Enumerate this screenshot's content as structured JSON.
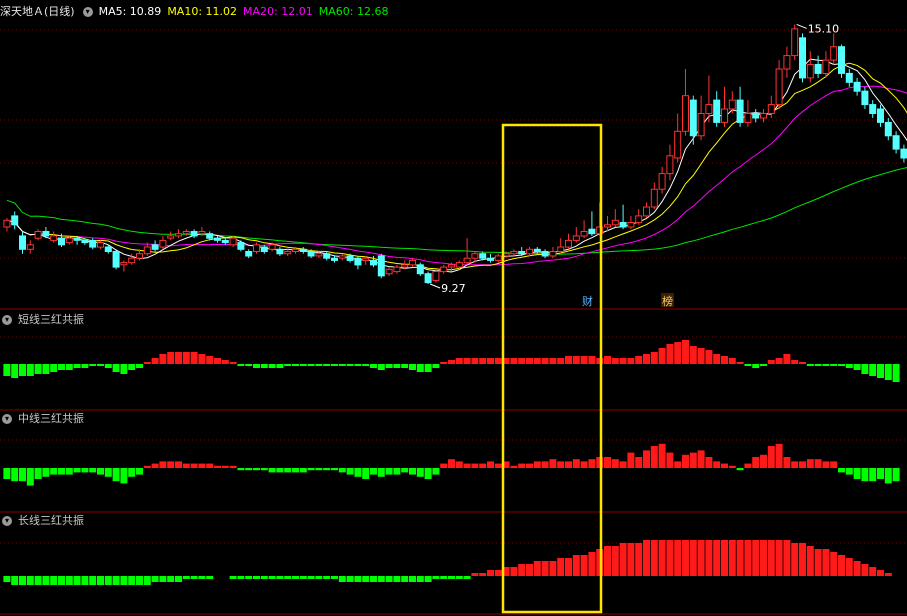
{
  "header": {
    "stock_name": "深天地Ａ",
    "period": "(日线)",
    "ma5": "MA5: 10.89",
    "ma10": "MA10: 11.02",
    "ma20": "MA20: 12.01",
    "ma60": "MA60: 12.68"
  },
  "colors": {
    "up": "#ff3232",
    "down": "#54ffff",
    "ma5": "#ffffff",
    "ma10": "#ffff00",
    "ma20": "#ff00ff",
    "ma60": "#00e600",
    "grid": "#7a0000",
    "highlight": "#ffe400",
    "hist_pos": "#ff1a1a",
    "hist_neg": "#00ff00"
  },
  "price_panel": {
    "high_label": "15.10",
    "low_label": "9.27",
    "marker_cai": "财",
    "marker_bang": "榜"
  },
  "indicators": [
    {
      "title": "短线三红共振"
    },
    {
      "title": "中线三红共振"
    },
    {
      "title": "长线三红共振"
    }
  ],
  "chart_data": {
    "type": "candlestick",
    "price_range": [
      9.0,
      15.2
    ],
    "candles": [
      {
        "o": 10.55,
        "c": 10.7,
        "h": 10.75,
        "l": 10.45
      },
      {
        "o": 10.8,
        "c": 10.6,
        "h": 10.9,
        "l": 10.5
      },
      {
        "o": 10.35,
        "c": 10.05,
        "h": 10.45,
        "l": 9.95
      },
      {
        "o": 10.05,
        "c": 10.15,
        "h": 10.25,
        "l": 9.95
      },
      {
        "o": 10.3,
        "c": 10.45,
        "h": 10.5,
        "l": 10.25
      },
      {
        "o": 10.45,
        "c": 10.35,
        "h": 10.55,
        "l": 10.3
      },
      {
        "o": 10.25,
        "c": 10.35,
        "h": 10.45,
        "l": 10.2
      },
      {
        "o": 10.3,
        "c": 10.15,
        "h": 10.4,
        "l": 10.1
      },
      {
        "o": 10.2,
        "c": 10.3,
        "h": 10.35,
        "l": 10.15
      },
      {
        "o": 10.3,
        "c": 10.25,
        "h": 10.35,
        "l": 10.15
      },
      {
        "o": 10.25,
        "c": 10.2,
        "h": 10.3,
        "l": 10.15
      },
      {
        "o": 10.25,
        "c": 10.1,
        "h": 10.3,
        "l": 10.05
      },
      {
        "o": 10.1,
        "c": 10.2,
        "h": 10.25,
        "l": 10.05
      },
      {
        "o": 10.1,
        "c": 10.0,
        "h": 10.15,
        "l": 9.95
      },
      {
        "o": 10.0,
        "c": 9.65,
        "h": 10.05,
        "l": 9.6
      },
      {
        "o": 9.7,
        "c": 9.75,
        "h": 9.8,
        "l": 9.55
      },
      {
        "o": 9.75,
        "c": 9.85,
        "h": 9.95,
        "l": 9.7
      },
      {
        "o": 9.85,
        "c": 9.95,
        "h": 10.05,
        "l": 9.8
      },
      {
        "o": 9.95,
        "c": 10.1,
        "h": 10.2,
        "l": 9.9
      },
      {
        "o": 10.15,
        "c": 10.05,
        "h": 10.25,
        "l": 10.0
      },
      {
        "o": 10.1,
        "c": 10.25,
        "h": 10.35,
        "l": 10.05
      },
      {
        "o": 10.3,
        "c": 10.35,
        "h": 10.45,
        "l": 10.25
      },
      {
        "o": 10.35,
        "c": 10.4,
        "h": 10.5,
        "l": 10.3
      },
      {
        "o": 10.4,
        "c": 10.45,
        "h": 10.5,
        "l": 10.35
      },
      {
        "o": 10.45,
        "c": 10.35,
        "h": 10.5,
        "l": 10.3
      },
      {
        "o": 10.4,
        "c": 10.45,
        "h": 10.55,
        "l": 10.35
      },
      {
        "o": 10.4,
        "c": 10.3,
        "h": 10.45,
        "l": 10.25
      },
      {
        "o": 10.3,
        "c": 10.25,
        "h": 10.35,
        "l": 10.2
      },
      {
        "o": 10.25,
        "c": 10.2,
        "h": 10.3,
        "l": 10.15
      },
      {
        "o": 10.15,
        "c": 10.3,
        "h": 10.35,
        "l": 10.1
      },
      {
        "o": 10.2,
        "c": 10.05,
        "h": 10.25,
        "l": 10.0
      },
      {
        "o": 10.0,
        "c": 9.9,
        "h": 10.05,
        "l": 9.85
      },
      {
        "o": 10.0,
        "c": 10.15,
        "h": 10.2,
        "l": 9.95
      },
      {
        "o": 10.1,
        "c": 10.0,
        "h": 10.15,
        "l": 9.95
      },
      {
        "o": 10.05,
        "c": 10.15,
        "h": 10.2,
        "l": 10.0
      },
      {
        "o": 10.05,
        "c": 9.95,
        "h": 10.1,
        "l": 9.9
      },
      {
        "o": 9.95,
        "c": 10.0,
        "h": 10.05,
        "l": 9.9
      },
      {
        "o": 10.0,
        "c": 10.05,
        "h": 10.1,
        "l": 9.95
      },
      {
        "o": 10.05,
        "c": 10.0,
        "h": 10.1,
        "l": 9.95
      },
      {
        "o": 10.0,
        "c": 9.9,
        "h": 10.05,
        "l": 9.85
      },
      {
        "o": 9.9,
        "c": 9.95,
        "h": 10.0,
        "l": 9.85
      },
      {
        "o": 9.95,
        "c": 9.85,
        "h": 10.0,
        "l": 9.8
      },
      {
        "o": 9.85,
        "c": 9.8,
        "h": 9.9,
        "l": 9.75
      },
      {
        "o": 9.85,
        "c": 9.9,
        "h": 9.95,
        "l": 9.8
      },
      {
        "o": 9.9,
        "c": 9.8,
        "h": 9.95,
        "l": 9.75
      },
      {
        "o": 9.85,
        "c": 9.7,
        "h": 9.9,
        "l": 9.6
      },
      {
        "o": 9.8,
        "c": 9.85,
        "h": 9.9,
        "l": 9.7
      },
      {
        "o": 9.8,
        "c": 9.7,
        "h": 9.9,
        "l": 9.65
      },
      {
        "o": 9.9,
        "c": 9.45,
        "h": 9.95,
        "l": 9.4
      },
      {
        "o": 9.5,
        "c": 9.6,
        "h": 9.65,
        "l": 9.45
      },
      {
        "o": 9.55,
        "c": 9.65,
        "h": 9.7,
        "l": 9.5
      },
      {
        "o": 9.65,
        "c": 9.7,
        "h": 9.8,
        "l": 9.6
      },
      {
        "o": 9.7,
        "c": 9.8,
        "h": 9.85,
        "l": 9.65
      },
      {
        "o": 9.7,
        "c": 9.5,
        "h": 9.75,
        "l": 9.45
      },
      {
        "o": 9.5,
        "c": 9.3,
        "h": 9.55,
        "l": 9.27
      },
      {
        "o": 9.35,
        "c": 9.55,
        "h": 9.6,
        "l": 9.3
      },
      {
        "o": 9.55,
        "c": 9.65,
        "h": 9.7,
        "l": 9.5
      },
      {
        "o": 9.65,
        "c": 9.7,
        "h": 9.75,
        "l": 9.55
      },
      {
        "o": 9.65,
        "c": 9.75,
        "h": 9.8,
        "l": 9.6
      },
      {
        "o": 9.75,
        "c": 9.85,
        "h": 10.3,
        "l": 9.7
      },
      {
        "o": 9.85,
        "c": 9.95,
        "h": 10.0,
        "l": 9.75
      },
      {
        "o": 9.95,
        "c": 9.85,
        "h": 10.0,
        "l": 9.8
      },
      {
        "o": 9.85,
        "c": 9.8,
        "h": 9.95,
        "l": 9.75
      },
      {
        "o": 9.8,
        "c": 9.9,
        "h": 9.95,
        "l": 9.75
      },
      {
        "o": 9.9,
        "c": 9.95,
        "h": 10.0,
        "l": 9.85
      },
      {
        "o": 9.95,
        "c": 10.0,
        "h": 10.05,
        "l": 9.9
      },
      {
        "o": 10.0,
        "c": 9.95,
        "h": 10.1,
        "l": 9.9
      },
      {
        "o": 9.95,
        "c": 10.05,
        "h": 10.1,
        "l": 9.9
      },
      {
        "o": 10.05,
        "c": 10.0,
        "h": 10.1,
        "l": 9.95
      },
      {
        "o": 10.0,
        "c": 9.9,
        "h": 10.05,
        "l": 9.85
      },
      {
        "o": 9.9,
        "c": 10.0,
        "h": 10.1,
        "l": 9.85
      },
      {
        "o": 10.0,
        "c": 10.1,
        "h": 10.3,
        "l": 9.95
      },
      {
        "o": 10.1,
        "c": 10.25,
        "h": 10.4,
        "l": 10.05
      },
      {
        "o": 10.25,
        "c": 10.35,
        "h": 10.55,
        "l": 10.2
      },
      {
        "o": 10.35,
        "c": 10.45,
        "h": 10.7,
        "l": 10.3
      },
      {
        "o": 10.5,
        "c": 10.4,
        "h": 10.9,
        "l": 10.35
      },
      {
        "o": 10.4,
        "c": 10.55,
        "h": 11.1,
        "l": 10.35
      },
      {
        "o": 10.55,
        "c": 10.6,
        "h": 10.8,
        "l": 10.45
      },
      {
        "o": 10.6,
        "c": 10.7,
        "h": 10.95,
        "l": 10.55
      },
      {
        "o": 10.65,
        "c": 10.55,
        "h": 11.05,
        "l": 10.5
      },
      {
        "o": 10.55,
        "c": 10.65,
        "h": 10.8,
        "l": 10.5
      },
      {
        "o": 10.65,
        "c": 10.8,
        "h": 10.95,
        "l": 10.6
      },
      {
        "o": 10.8,
        "c": 11.0,
        "h": 11.1,
        "l": 10.75
      },
      {
        "o": 11.0,
        "c": 11.4,
        "h": 11.55,
        "l": 10.95
      },
      {
        "o": 11.4,
        "c": 11.75,
        "h": 11.9,
        "l": 11.3
      },
      {
        "o": 11.75,
        "c": 12.15,
        "h": 12.4,
        "l": 11.6
      },
      {
        "o": 12.1,
        "c": 12.7,
        "h": 13.1,
        "l": 12.0
      },
      {
        "o": 12.7,
        "c": 13.5,
        "h": 14.1,
        "l": 12.6
      },
      {
        "o": 13.4,
        "c": 12.6,
        "h": 13.5,
        "l": 12.4
      },
      {
        "o": 12.6,
        "c": 13.1,
        "h": 13.5,
        "l": 12.5
      },
      {
        "o": 13.1,
        "c": 13.3,
        "h": 13.95,
        "l": 12.9
      },
      {
        "o": 13.4,
        "c": 12.9,
        "h": 13.6,
        "l": 12.8
      },
      {
        "o": 12.9,
        "c": 13.2,
        "h": 13.7,
        "l": 12.8
      },
      {
        "o": 13.2,
        "c": 13.4,
        "h": 13.6,
        "l": 13.1
      },
      {
        "o": 13.4,
        "c": 12.9,
        "h": 13.7,
        "l": 12.8
      },
      {
        "o": 12.9,
        "c": 13.1,
        "h": 13.4,
        "l": 12.8
      },
      {
        "o": 13.1,
        "c": 13.0,
        "h": 13.2,
        "l": 12.9
      },
      {
        "o": 13.0,
        "c": 13.1,
        "h": 13.2,
        "l": 12.9
      },
      {
        "o": 13.1,
        "c": 13.3,
        "h": 13.5,
        "l": 13.0
      },
      {
        "o": 13.3,
        "c": 14.1,
        "h": 14.3,
        "l": 13.2
      },
      {
        "o": 14.1,
        "c": 14.4,
        "h": 14.6,
        "l": 13.9
      },
      {
        "o": 14.4,
        "c": 15.0,
        "h": 15.1,
        "l": 14.3
      },
      {
        "o": 14.8,
        "c": 13.9,
        "h": 14.9,
        "l": 13.8
      },
      {
        "o": 13.9,
        "c": 14.2,
        "h": 14.5,
        "l": 13.8
      },
      {
        "o": 14.2,
        "c": 14.0,
        "h": 14.4,
        "l": 13.9
      },
      {
        "o": 14.0,
        "c": 14.3,
        "h": 14.5,
        "l": 13.9
      },
      {
        "o": 14.3,
        "c": 14.6,
        "h": 14.9,
        "l": 14.2
      },
      {
        "o": 14.6,
        "c": 14.0,
        "h": 14.65,
        "l": 13.9
      },
      {
        "o": 14.0,
        "c": 13.8,
        "h": 14.1,
        "l": 13.7
      },
      {
        "o": 13.8,
        "c": 13.6,
        "h": 13.9,
        "l": 13.5
      },
      {
        "o": 13.6,
        "c": 13.3,
        "h": 13.7,
        "l": 13.2
      },
      {
        "o": 13.3,
        "c": 13.1,
        "h": 13.4,
        "l": 13.0
      },
      {
        "o": 13.2,
        "c": 12.9,
        "h": 13.3,
        "l": 12.8
      },
      {
        "o": 12.9,
        "c": 12.6,
        "h": 13.0,
        "l": 12.5
      },
      {
        "o": 12.6,
        "c": 12.3,
        "h": 12.7,
        "l": 12.2
      },
      {
        "o": 12.3,
        "c": 12.1,
        "h": 12.4,
        "l": 12.0
      },
      {
        "o": 12.2,
        "c": 11.8,
        "h": 12.3,
        "l": 11.7
      }
    ],
    "hist_short": [
      -6,
      -7,
      -6,
      -6,
      -5,
      -5,
      -4,
      -3,
      -3,
      -2,
      -2,
      -1,
      -1,
      -2,
      -4,
      -5,
      -3,
      -2,
      1,
      3,
      5,
      6,
      6,
      6,
      6,
      5,
      4,
      3,
      2,
      1,
      -1,
      -1,
      -2,
      -2,
      -2,
      -2,
      -1,
      -1,
      -1,
      -1,
      -1,
      -1,
      -1,
      -1,
      -1,
      -1,
      -1,
      -2,
      -3,
      -2,
      -2,
      -2,
      -3,
      -4,
      -4,
      -2,
      1,
      2,
      3,
      3,
      3,
      3,
      3,
      3,
      3,
      3,
      3,
      3,
      3,
      3,
      3,
      3,
      4,
      4,
      4,
      4,
      3,
      4,
      3,
      3,
      3,
      4,
      5,
      6,
      8,
      10,
      11,
      12,
      9,
      8,
      7,
      5,
      4,
      3,
      1,
      -1,
      -2,
      -1,
      2,
      3,
      5,
      2,
      1,
      -1,
      -1,
      -1,
      -1,
      -1,
      -2,
      -3,
      -5,
      -6,
      -7,
      -8,
      -9
    ],
    "hist_mid": [
      -5,
      -6,
      -6,
      -8,
      -5,
      -4,
      -3,
      -3,
      -3,
      -2,
      -2,
      -2,
      -3,
      -4,
      -6,
      -7,
      -4,
      -3,
      1,
      2,
      3,
      3,
      3,
      2,
      2,
      2,
      2,
      1,
      1,
      1,
      -1,
      -1,
      -1,
      -1,
      -2,
      -2,
      -2,
      -2,
      -2,
      -1,
      -1,
      -1,
      -1,
      -2,
      -3,
      -4,
      -5,
      -3,
      -4,
      -3,
      -3,
      -2,
      -3,
      -4,
      -5,
      -3,
      2,
      4,
      3,
      2,
      2,
      2,
      3,
      2,
      3,
      1,
      2,
      2,
      3,
      3,
      4,
      3,
      3,
      4,
      3,
      4,
      5,
      5,
      4,
      3,
      7,
      5,
      8,
      10,
      11,
      7,
      3,
      6,
      7,
      8,
      5,
      3,
      2,
      1,
      -1,
      2,
      5,
      6,
      10,
      11,
      5,
      3,
      3,
      4,
      4,
      3,
      3,
      -2,
      -3,
      -5,
      -6,
      -6,
      -5,
      -7,
      -6
    ],
    "hist_long": [
      -2,
      -3,
      -3,
      -3,
      -3,
      -3,
      -3,
      -3,
      -3,
      -3,
      -3,
      -3,
      -3,
      -3,
      -3,
      -3,
      -3,
      -3,
      -3,
      -2,
      -2,
      -2,
      -2,
      -1,
      -1,
      -1,
      -1,
      0,
      0,
      -1,
      -1,
      -1,
      -1,
      -1,
      -1,
      -1,
      -1,
      -1,
      -1,
      -1,
      -1,
      -1,
      -1,
      -2,
      -2,
      -2,
      -2,
      -2,
      -2,
      -2,
      -2,
      -2,
      -2,
      -2,
      -2,
      -1,
      -1,
      -1,
      -1,
      -1,
      1,
      1,
      2,
      2,
      3,
      3,
      4,
      4,
      5,
      5,
      5,
      6,
      6,
      7,
      7,
      8,
      9,
      10,
      10,
      11,
      11,
      11,
      12,
      12,
      12,
      12,
      12,
      12,
      12,
      12,
      12,
      12,
      12,
      12,
      12,
      12,
      12,
      12,
      12,
      12,
      12,
      11,
      11,
      10,
      9,
      9,
      8,
      7,
      6,
      5,
      4,
      3,
      2,
      1
    ]
  }
}
